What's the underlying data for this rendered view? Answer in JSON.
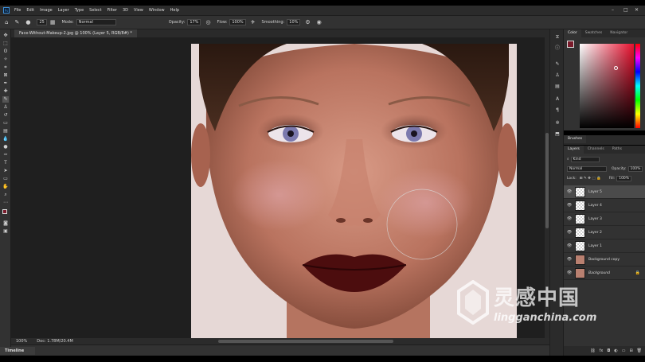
{
  "menubar": {
    "app_icon": "Ps",
    "items": [
      "File",
      "Edit",
      "Image",
      "Layer",
      "Type",
      "Select",
      "Filter",
      "3D",
      "View",
      "Window",
      "Help"
    ],
    "window_controls": [
      "–",
      "□",
      "✕"
    ]
  },
  "options": {
    "brush_size": "25",
    "mode_label": "Mode:",
    "mode_value": "Normal",
    "opacity_label": "Opacity:",
    "opacity_value": "17%",
    "flow_label": "Flow:",
    "flow_value": "100%",
    "smoothing_label": "Smoothing:",
    "smoothing_value": "10%"
  },
  "document": {
    "tab_title": "Face-Without-Makeup-2.jpg @ 100% (Layer 5, RGB/8#) *",
    "zoom": "100%",
    "doc_info": "Doc: 1.78M/20.4M"
  },
  "timeline": {
    "label": "Timeline"
  },
  "color_panel": {
    "tabs": [
      "Color",
      "Swatches",
      "Navigator"
    ],
    "foreground_color": "#7a1b2b",
    "background_color": "#ffffff"
  },
  "brushes_panel": {
    "label": "Brushes"
  },
  "layers_panel": {
    "tabs": [
      "Layers",
      "Channels",
      "Paths"
    ],
    "filter_label": "Kind",
    "blend_mode": "Normal",
    "opacity_label": "Opacity:",
    "opacity_value": "100%",
    "lock_label": "Lock:",
    "fill_label": "Fill:",
    "fill_value": "100%",
    "layers": [
      {
        "name": "Layer 5",
        "selected": true,
        "thumb": "transparent"
      },
      {
        "name": "Layer 4",
        "selected": false,
        "thumb": "transparent"
      },
      {
        "name": "Layer 3",
        "selected": false,
        "thumb": "transparent"
      },
      {
        "name": "Layer 2",
        "selected": false,
        "thumb": "transparent"
      },
      {
        "name": "Layer 1",
        "selected": false,
        "thumb": "transparent"
      },
      {
        "name": "Background copy",
        "selected": false,
        "thumb": "face"
      },
      {
        "name": "Background",
        "selected": false,
        "thumb": "face",
        "locked": true
      }
    ]
  },
  "watermark": {
    "cn": "灵感中国",
    "en": "lingganchina.com"
  },
  "icons": {
    "app": "photoshop-icon",
    "home": "home-icon",
    "brush": "brush-icon",
    "eye": "eye-icon",
    "lock": "lock-icon"
  }
}
